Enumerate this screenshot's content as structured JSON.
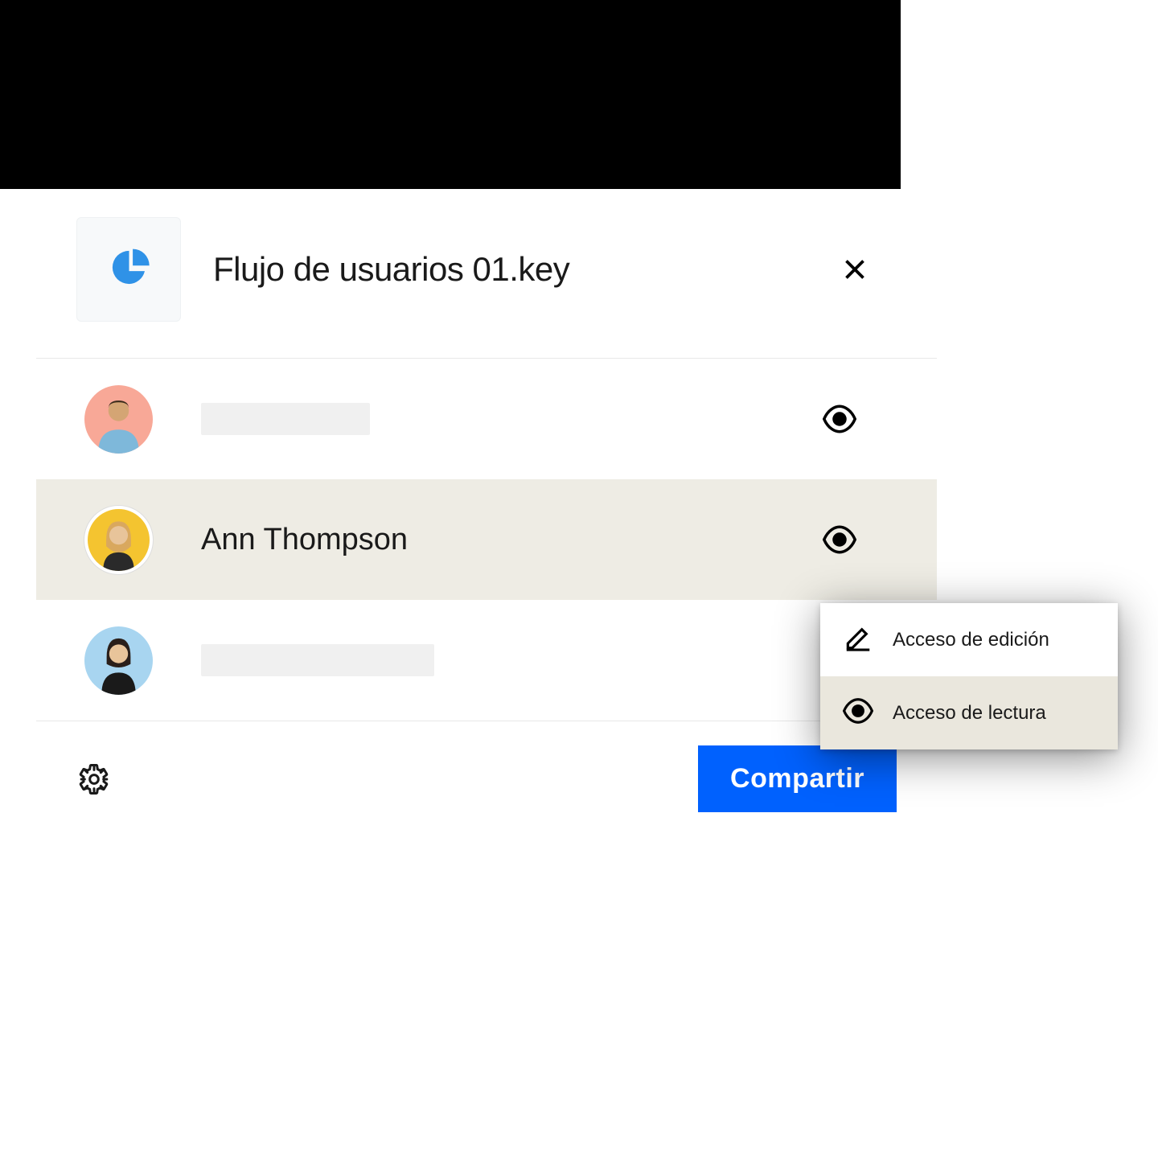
{
  "file": {
    "title": "Flujo de usuarios 01.key"
  },
  "users": [
    {
      "name": ""
    },
    {
      "name": "Ann Thompson"
    },
    {
      "name": ""
    }
  ],
  "dropdown": {
    "edit_label": "Acceso de edición",
    "read_label": "Acceso de lectura"
  },
  "footer": {
    "share_label": "Compartir"
  }
}
